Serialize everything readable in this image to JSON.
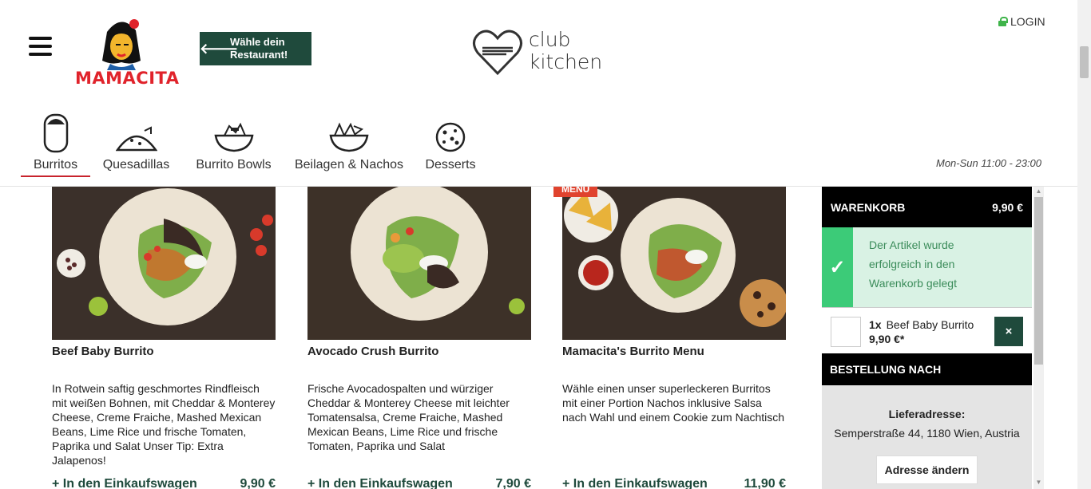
{
  "header": {
    "brand": "MAMACITA",
    "choose_button": "Wähle dein Restaurant!",
    "club_logo": "club kitchen",
    "login": "LOGIN",
    "hours": "Mon-Sun 11:00 - 23:00",
    "colors": {
      "accent": "#1f4a3c",
      "brand_red": "#e0232b",
      "active_underline": "#c8232c"
    }
  },
  "categories": [
    {
      "label": "Burritos",
      "icon": "burrito-icon",
      "active": true
    },
    {
      "label": "Quesadillas",
      "icon": "quesadilla-icon",
      "active": false
    },
    {
      "label": "Burrito Bowls",
      "icon": "bowl-icon",
      "active": false
    },
    {
      "label": "Beilagen & Nachos",
      "icon": "nachos-icon",
      "active": false
    },
    {
      "label": "Desserts",
      "icon": "cookie-icon",
      "active": false
    }
  ],
  "products": [
    {
      "title": "Beef Baby Burrito",
      "desc": "In Rotwein saftig geschmortes Rindfleisch mit weißen Bohnen, mit Cheddar & Monterey Cheese, Creme Fraiche, Mashed Mexican Beans, Lime Rice und frische Tomaten, Paprika und Salat Unser Tip: Extra Jalapenos!",
      "add": "+ In den Einkaufswagen",
      "price": "9,90 €"
    },
    {
      "title": "Avocado Crush Burrito",
      "desc": "Frische Avocadospalten und würziger Cheddar & Monterey Cheese mit leichter Tomatensalsa, Creme Fraiche, Mashed Mexican Beans, Lime Rice und frische Tomaten, Paprika und Salat",
      "add": "+ In den Einkaufswagen",
      "price": "7,90 €"
    },
    {
      "title": "Mamacita's Burrito Menu",
      "desc": "Wähle einen unser superleckeren Burritos mit einer Portion Nachos inklusive Salsa nach Wahl und einem Cookie zum Nachtisch",
      "add": "+ In den Einkaufswagen",
      "price": "11,90 €",
      "badge": "MENU"
    }
  ],
  "cart": {
    "title": "WARENKORB",
    "total": "9,90 €",
    "success": "Der Artikel wurde erfolgreich in den Warenkorb gelegt",
    "item_qty": "1x",
    "item_name": "Beef Baby Burrito",
    "item_price": "9,90 €*",
    "remove": "×",
    "order_title": "BESTELLUNG NACH",
    "addr_label": "Lieferadresse:",
    "addr_value": "Semperstraße 44, 1180 Wien, Austria",
    "addr_button": "Adresse ändern"
  }
}
